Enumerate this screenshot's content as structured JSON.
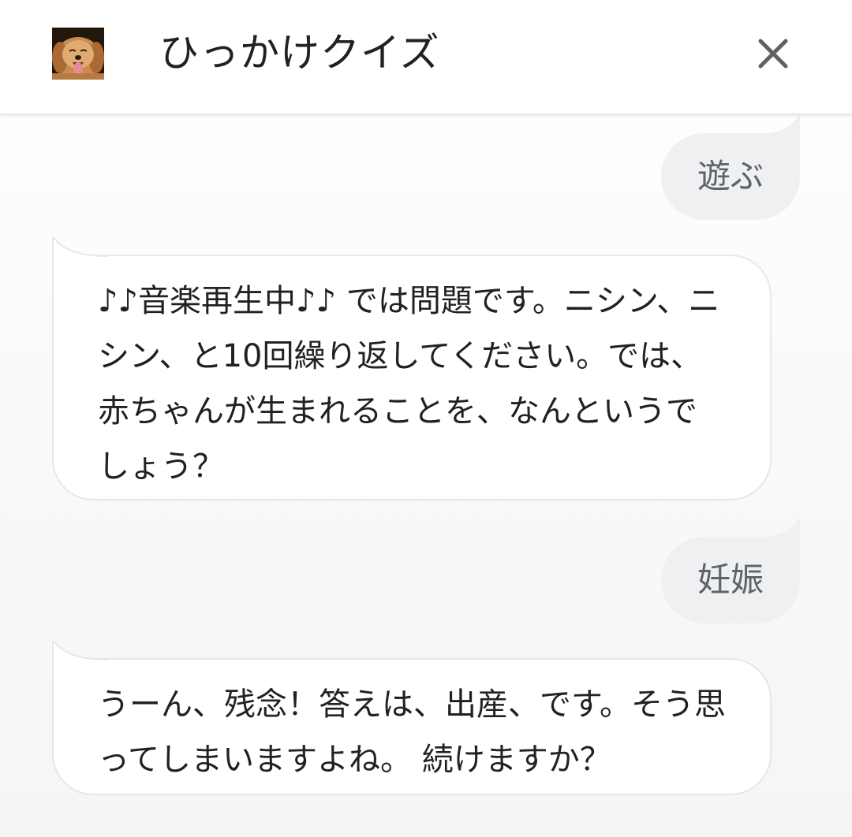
{
  "header": {
    "title": "ひっかけクイズ",
    "avatar_icon": "puppy-avatar",
    "close_icon": "close-icon"
  },
  "messages": [
    {
      "role": "user",
      "text": "遊ぶ"
    },
    {
      "role": "bot",
      "text": "♪♪音楽再生中♪♪ では問題です。ニシン、ニシン、と10回繰り返してください。では、赤ちゃんが生まれることを、なんというでしょう？"
    },
    {
      "role": "user",
      "text": "妊娠"
    },
    {
      "role": "bot",
      "text": "うーん、残念！答えは、出産、です。そう思ってしまいますよね。 続けますか？"
    }
  ],
  "colors": {
    "user_bubble": "#eff0f2",
    "user_text": "#5f6368",
    "bot_bubble": "#ffffff",
    "bot_border": "#e6e7e9",
    "text": "#202124"
  }
}
